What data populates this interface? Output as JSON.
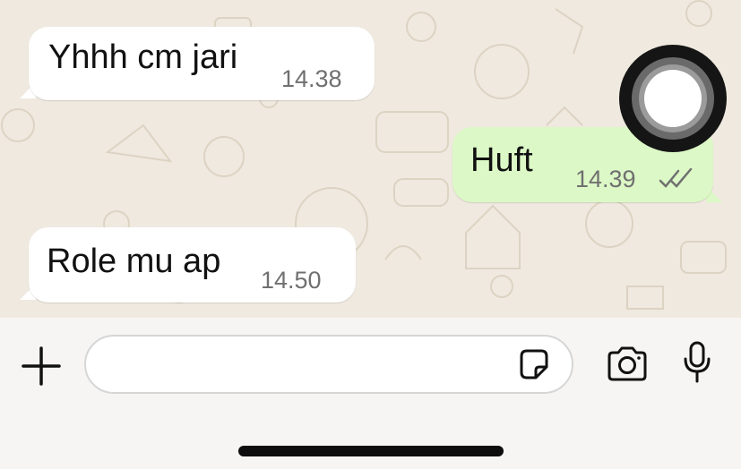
{
  "messages": [
    {
      "direction": "incoming",
      "text": "Yhhh cm jari",
      "time": "14.38"
    },
    {
      "direction": "outgoing",
      "text": "Huft",
      "time": "14.39",
      "status": "double-check-read"
    },
    {
      "direction": "incoming",
      "text": "Role mu ap",
      "time": "14.50"
    }
  ],
  "composer": {
    "placeholder": "",
    "value": ""
  },
  "colors": {
    "wallpaper": "#efe9df",
    "incoming_bubble": "#ffffff",
    "outgoing_bubble": "#dcf8c6",
    "timestamp": "#707070",
    "read_check": "#707070"
  },
  "icons": {
    "attach": "plus-icon",
    "sticker": "sticker-icon",
    "camera": "camera-icon",
    "voice": "microphone-icon",
    "assistive": "assistive-touch-icon"
  }
}
